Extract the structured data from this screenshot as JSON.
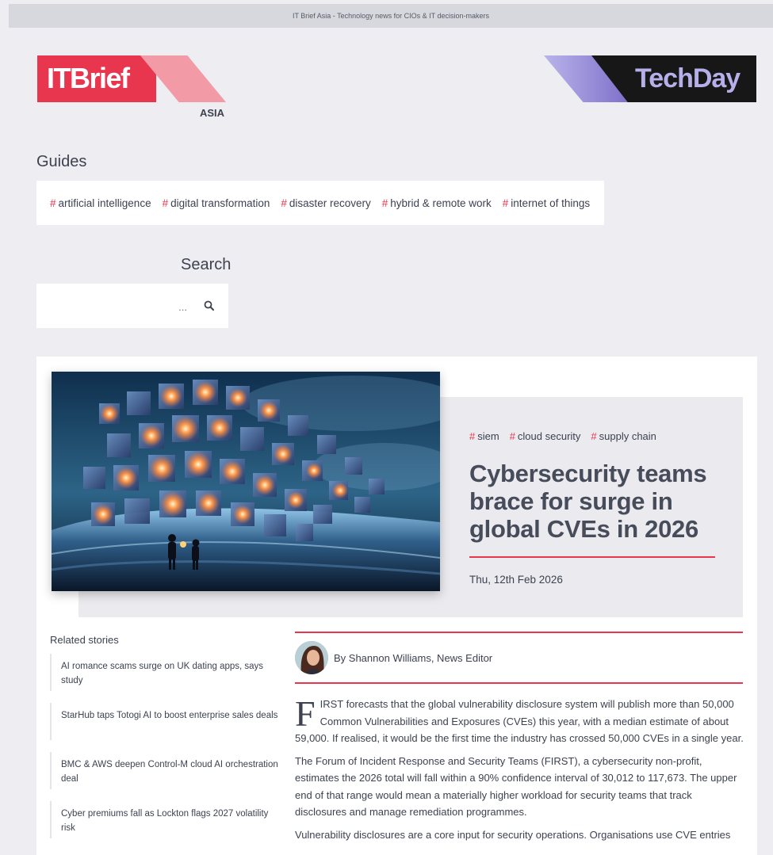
{
  "topbar": {
    "text": "IT Brief Asia - Technology news for CIOs & IT decision-makers"
  },
  "logos": {
    "itbrief": "ITBrief",
    "region": "ASIA",
    "techday": "TechDay"
  },
  "guides": {
    "title": "Guides",
    "tags": [
      "artificial intelligence",
      "digital transformation",
      "disaster recovery",
      "hybrid & remote work",
      "internet of things"
    ],
    "hash": "#"
  },
  "search": {
    "title": "Search",
    "placeholder": "...",
    "icon": "search-icon"
  },
  "hero": {
    "tags": [
      "siem",
      "cloud security",
      "supply chain"
    ],
    "title": "Cybersecurity teams brace for surge in global CVEs in 2026",
    "date": "Thu, 12th Feb 2026"
  },
  "related": {
    "title": "Related stories",
    "items": [
      "AI romance scams surge on UK dating apps, says study",
      "StarHub taps Totogi AI to boost enterprise sales deals",
      "BMC & AWS deepen Control-M cloud AI orchestration deal",
      "Cyber premiums fall as Lockton flags 2027 volatility risk"
    ]
  },
  "article": {
    "byline": "By Shannon Williams, News Editor",
    "dropcap": "F",
    "p1": "IRST forecasts that the global vulnerability disclosure system will publish more than 50,000 Common Vulnerabilities and Exposures (CVEs) this year, with a median estimate of about 59,000. If realised, it would be the first time the industry has crossed 50,000 CVEs in a single year.",
    "p2": "The Forum of Incident Response and Security Teams (FIRST), a cybersecurity non-profit, estimates the 2026 total will fall within a 90% confidence interval of 30,012 to 117,673. The upper end of that range would mean a materially higher workload for security teams that track disclosures and manage remediation programmes.",
    "p3": "Vulnerability disclosures are a core input for security operations. Organisations use CVE entries"
  },
  "colors": {
    "accent": "#e8364e",
    "background": "#eeeef2",
    "text": "#3d4250"
  }
}
